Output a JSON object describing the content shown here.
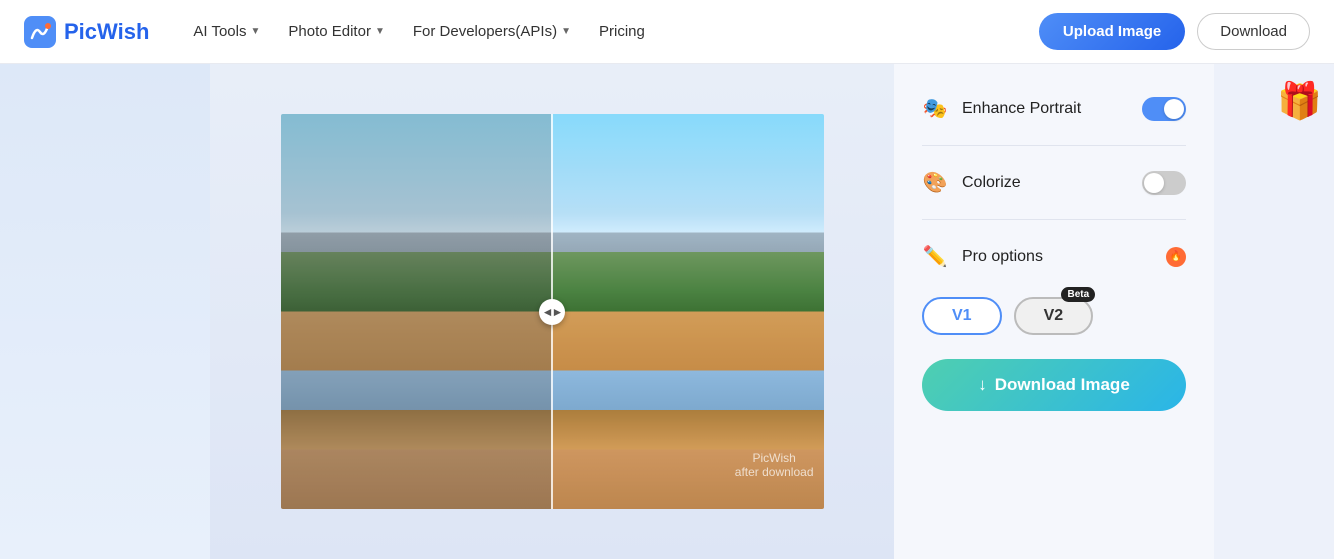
{
  "header": {
    "logo_text": "PicWish",
    "nav_items": [
      {
        "label": "AI Tools",
        "has_dropdown": true
      },
      {
        "label": "Photo Editor",
        "has_dropdown": true
      },
      {
        "label": "For Developers(APIs)",
        "has_dropdown": true
      },
      {
        "label": "Pricing",
        "has_dropdown": false
      }
    ],
    "upload_btn": "Upload Image",
    "download_btn": "Download"
  },
  "controls": {
    "enhance_portrait": {
      "label": "Enhance Portrait",
      "enabled": true
    },
    "colorize": {
      "label": "Colorize",
      "enabled": false
    },
    "pro_options": {
      "label": "Pro options"
    },
    "v1_label": "V1",
    "v2_label": "V2",
    "beta_label": "Beta",
    "download_image_btn": "Download Image"
  },
  "watermark": {
    "line1": "PicWish",
    "line2": "after download"
  }
}
